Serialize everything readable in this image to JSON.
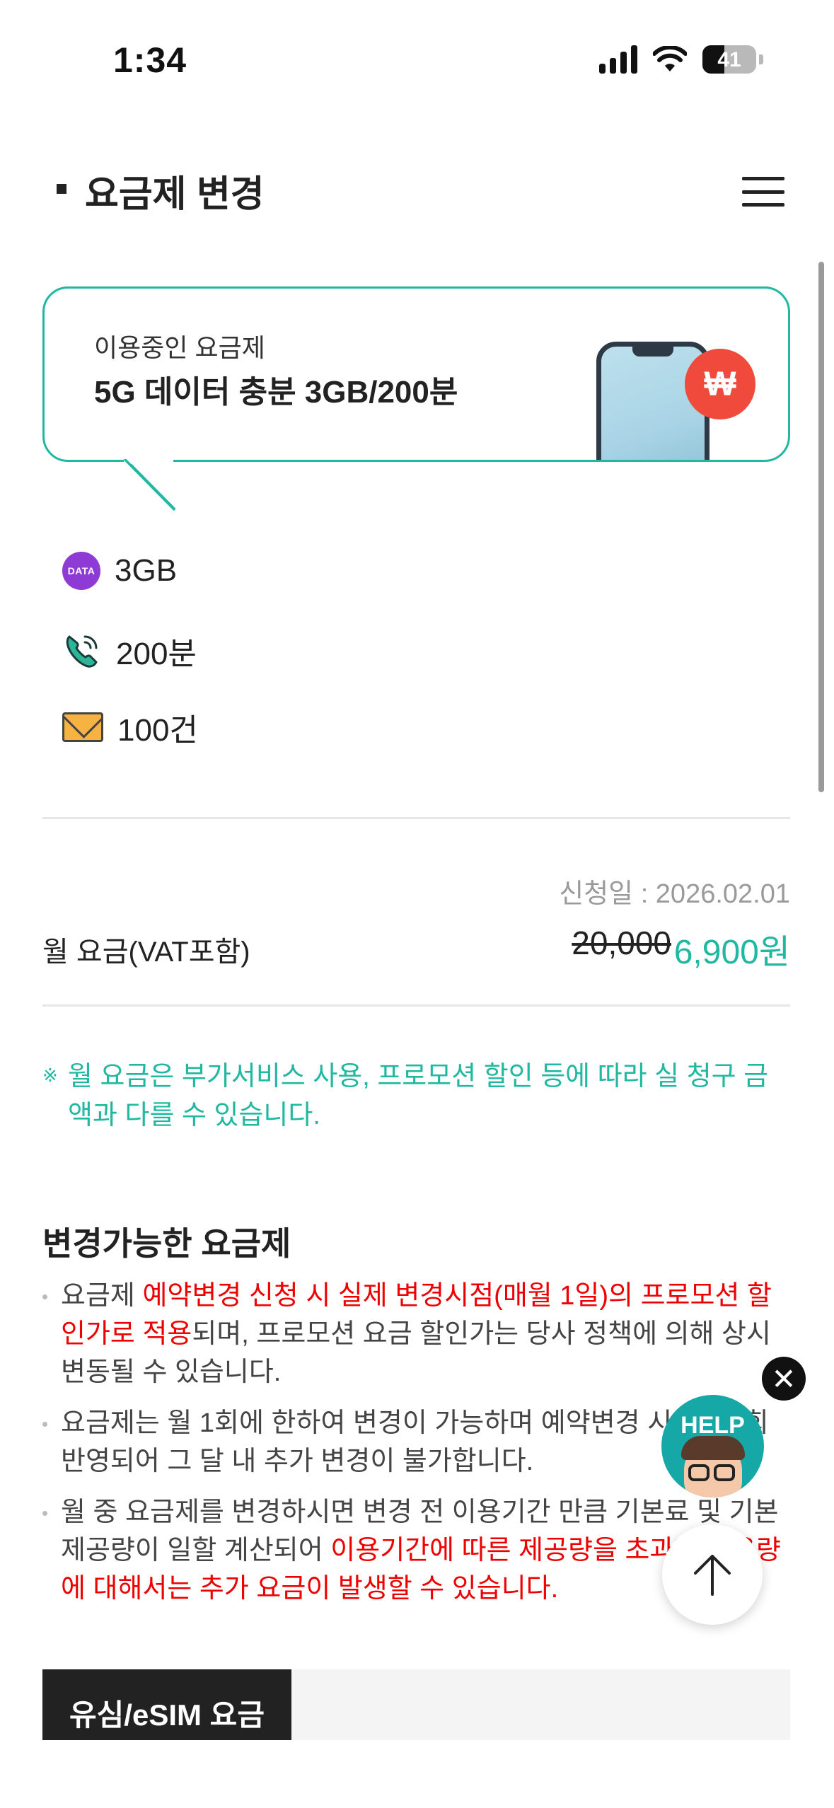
{
  "status_bar": {
    "time": "1:34",
    "battery": "41",
    "battery_level_percent": 41,
    "icons": [
      "cellular-signal-icon",
      "wifi-icon",
      "battery-icon"
    ]
  },
  "header": {
    "title": "요금제 변경",
    "menu_icon": "hamburger-menu-icon"
  },
  "current_plan": {
    "label": "이용중인 요금제",
    "name": "5G 데이터 충분 3GB/200분",
    "badge_symbol": "₩"
  },
  "features": [
    {
      "icon": "data-icon",
      "icon_text": "DATA",
      "value": "3GB"
    },
    {
      "icon": "phone-call-icon",
      "value": "200분"
    },
    {
      "icon": "mail-icon",
      "value": "100건"
    }
  ],
  "pricing": {
    "apply_date": "신청일 : 2026.02.01",
    "label": "월 요금(VAT포함)",
    "original_price": "20,000",
    "discounted_price": "6,900원"
  },
  "notice": {
    "mark": "※",
    "text": "월 요금은 부가서비스 사용, 프로모션 할인 등에 따라 실 청구 금액과 다를 수 있습니다."
  },
  "changeable": {
    "title": "변경가능한 요금제",
    "bullet1": {
      "a": "요금제 ",
      "b_red": "예약변경 신청 시 실제 변경시점(매월 1일)의 프로모션 할인가로 적용",
      "c": "되며, 프로모션 요금 할인가는 당사 정책에 의해 상시 변동될 수 있습니다."
    },
    "bullet2": "요금제는 월 1회에 한하여 변경이 가능하며 예약변경 시에도 1회 반영되어 그 달 내 추가 변경이 불가합니다.",
    "bullet3": {
      "a": "월 중 요금제를 변경하시면 변경 전 이용기간 만큼 기본료 및 기본 제공량이 일할 계산되어 ",
      "b_red": "이용기간에 따른 제공량을 초과한 사용량에 대해서는 추가 요금이 발생할 수 있습니다."
    }
  },
  "floating": {
    "close_symbol": "✕",
    "help_label": "HELP"
  },
  "tabs": {
    "active": "유심/eSIM 요금"
  },
  "colors": {
    "accent": "#20b8a0",
    "alert": "#ee0000",
    "won_badge": "#ef4a3c",
    "data_badge": "#8e3ad4"
  }
}
